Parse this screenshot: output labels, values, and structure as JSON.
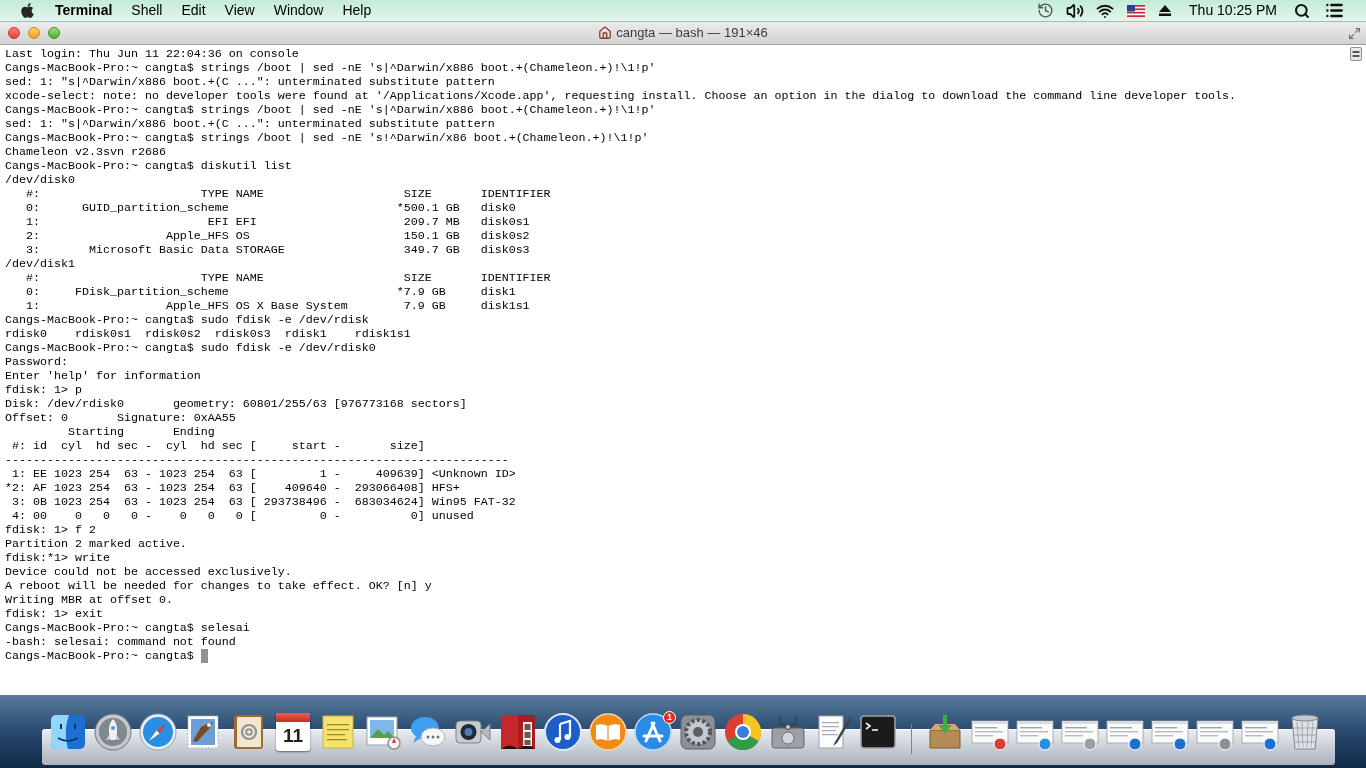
{
  "menu_bar": {
    "app_name": "Terminal",
    "menus": [
      "Shell",
      "Edit",
      "View",
      "Window",
      "Help"
    ],
    "clock": "Thu 10:25 PM"
  },
  "window": {
    "title": "cangta — bash — 191×46"
  },
  "terminal": {
    "lines": [
      "Last login: Thu Jun 11 22:04:36 on console",
      "Cangs-MacBook-Pro:~ cangta$ strings /boot | sed -nE 's|^Darwin/x886 boot.+(Chameleon.+)!\\1!p'",
      "sed: 1: \"s|^Darwin/x886 boot.+(C ...\": unterminated substitute pattern",
      "xcode-select: note: no developer tools were found at '/Applications/Xcode.app', requesting install. Choose an option in the dialog to download the command line developer tools.",
      "Cangs-MacBook-Pro:~ cangta$ strings /boot | sed -nE 's|^Darwin/x886 boot.+(Chameleon.+)!\\1!p'",
      "sed: 1: \"s|^Darwin/x886 boot.+(C ...\": unterminated substitute pattern",
      "Cangs-MacBook-Pro:~ cangta$ strings /boot | sed -nE 's!^Darwin/x86 boot.+(Chameleon.+)!\\1!p'",
      "Chameleon v2.3svn r2686",
      "Cangs-MacBook-Pro:~ cangta$ diskutil list",
      "/dev/disk0",
      "   #:                       TYPE NAME                    SIZE       IDENTIFIER",
      "   0:      GUID_partition_scheme                        *500.1 GB   disk0",
      "   1:                        EFI EFI                     209.7 MB   disk0s1",
      "   2:                  Apple_HFS OS                      150.1 GB   disk0s2",
      "   3:       Microsoft Basic Data STORAGE                 349.7 GB   disk0s3",
      "/dev/disk1",
      "   #:                       TYPE NAME                    SIZE       IDENTIFIER",
      "   0:     FDisk_partition_scheme                        *7.9 GB     disk1",
      "   1:                  Apple_HFS OS X Base System        7.9 GB     disk1s1",
      "Cangs-MacBook-Pro:~ cangta$ sudo fdisk -e /dev/rdisk",
      "rdisk0    rdisk0s1  rdisk0s2  rdisk0s3  rdisk1    rdisk1s1",
      "Cangs-MacBook-Pro:~ cangta$ sudo fdisk -e /dev/rdisk0",
      "Password:",
      "Enter 'help' for information",
      "fdisk: 1> p",
      "Disk: /dev/rdisk0       geometry: 60801/255/63 [976773168 sectors]",
      "Offset: 0       Signature: 0xAA55",
      "         Starting       Ending",
      " #: id  cyl  hd sec -  cyl  hd sec [     start -       size]",
      "------------------------------------------------------------------------",
      " 1: EE 1023 254  63 - 1023 254  63 [         1 -     409639] <Unknown ID>",
      "*2: AF 1023 254  63 - 1023 254  63 [    409640 -  293066408] HFS+",
      " 3: 0B 1023 254  63 - 1023 254  63 [ 293738496 -  683034624] Win95 FAT-32",
      " 4: 00    0   0   0 -    0   0   0 [         0 -          0] unused",
      "fdisk: 1> f 2",
      "Partition 2 marked active.",
      "fdisk:*1> write",
      "Device could not be accessed exclusively.",
      "A reboot will be needed for changes to take effect. OK? [n] y",
      "Writing MBR at offset 0.",
      "fdisk: 1> exit",
      "Cangs-MacBook-Pro:~ cangta$ selesai",
      "-bash: selesai: command not found"
    ],
    "prompt": "Cangs-MacBook-Pro:~ cangta$",
    "cursor": true
  },
  "dock": {
    "calendar_day": "11",
    "app_store_badge": "1"
  }
}
